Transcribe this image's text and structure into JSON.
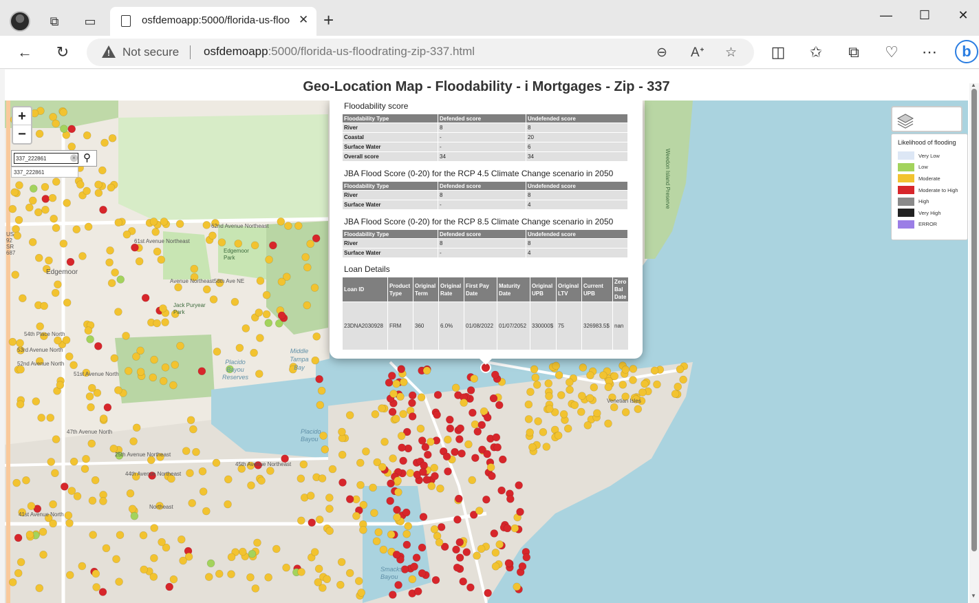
{
  "browser": {
    "tab_title": "osfdemoapp:5000/florida-us-floo",
    "security_label": "Not secure",
    "url_host": "osfdemoapp",
    "url_rest": ":5000/florida-us-floodrating-zip-337.html"
  },
  "page": {
    "title": "Geo-Location Map - Floodability - i Mortgages - Zip - 337"
  },
  "map": {
    "zoom_in": "+",
    "zoom_out": "−",
    "search_value": "337_222861",
    "search_suggestion": "337_222861",
    "labels": {
      "road_62nd": "62nd Avenue Northeast",
      "road_61st": "61st Avenue Northeast",
      "road_58th": "Avenue Northeast58th Ave NE",
      "edgemoor": "Edgemoor",
      "edgemoor_park": "Edgemoor Park",
      "jack_puryear": "Jack Puryear Park",
      "middle_tampa_bay": "Middle Tampa Bay",
      "placido_reserves": "Placido Bayou Reserves",
      "placido_bayou": "Placido Bayou",
      "smacks_bayou": "Smacks Bayou",
      "venetian_isles": "Venetian Isles",
      "road_54th": "54th Place North",
      "road_53rd": "53rd Avenue North",
      "road_52nd": "52nd Avenue North",
      "road_51st": "51st Avenue North",
      "road_47th": "47th Avenue North",
      "road_45th": "45th Avenue Northeast",
      "road_44th": "44th Avenue Northeast",
      "road_41st": "41st Avenue North",
      "road_25th": "25th Avenue Northeast",
      "northeast": "Northeast",
      "us92": "US 92 SR 687",
      "weedon_island": "Weedon Island Preserve"
    },
    "legend": {
      "title": "Likelihood of flooding",
      "items": [
        {
          "label": "Very Low",
          "color": "#dde7f5"
        },
        {
          "label": "Low",
          "color": "#a3d35c"
        },
        {
          "label": "Moderate",
          "color": "#f2c330"
        },
        {
          "label": "Moderate to High",
          "color": "#d7262b"
        },
        {
          "label": "High",
          "color": "#8a8a8a"
        },
        {
          "label": "Very High",
          "color": "#222222"
        },
        {
          "label": "ERROR",
          "color": "#9b7ee6"
        }
      ]
    }
  },
  "popup": {
    "floodability": {
      "title": "Floodability score",
      "headers": [
        "Floodability Type",
        "Defended score",
        "Undefended score"
      ],
      "rows": [
        [
          "River",
          "8",
          "8"
        ],
        [
          "Coastal",
          "-",
          "20"
        ],
        [
          "Surface Water",
          "-",
          "6"
        ],
        [
          "Overall score",
          "34",
          "34"
        ]
      ]
    },
    "rcp45": {
      "title": "JBA Flood Score (0-20) for the RCP 4.5 Climate Change scenario in 2050",
      "headers": [
        "Floodability Type",
        "Defended score",
        "Undefended score"
      ],
      "rows": [
        [
          "River",
          "8",
          "8"
        ],
        [
          "Surface Water",
          "-",
          "4"
        ]
      ]
    },
    "rcp85": {
      "title": "JBA Flood Score (0-20) for the RCP 8.5 Climate Change scenario in 2050",
      "headers": [
        "Floodability Type",
        "Defended score",
        "Undefended score"
      ],
      "rows": [
        [
          "River",
          "8",
          "8"
        ],
        [
          "Surface Water",
          "-",
          "4"
        ]
      ]
    },
    "loan": {
      "title": "Loan Details",
      "headers": [
        "Loan ID",
        "Product Type",
        "Original Term",
        "Original Rate",
        "First Pay Date",
        "Maturity Date",
        "Original UPB",
        "Original LTV",
        "Current UPB",
        "Zero Bal Date"
      ],
      "row": [
        "23DNA2030928",
        "FRM",
        "360",
        "6.0%",
        "01/08/2022",
        "01/07/2052",
        "330000$",
        "75",
        "326983.5$",
        "nan"
      ]
    }
  }
}
